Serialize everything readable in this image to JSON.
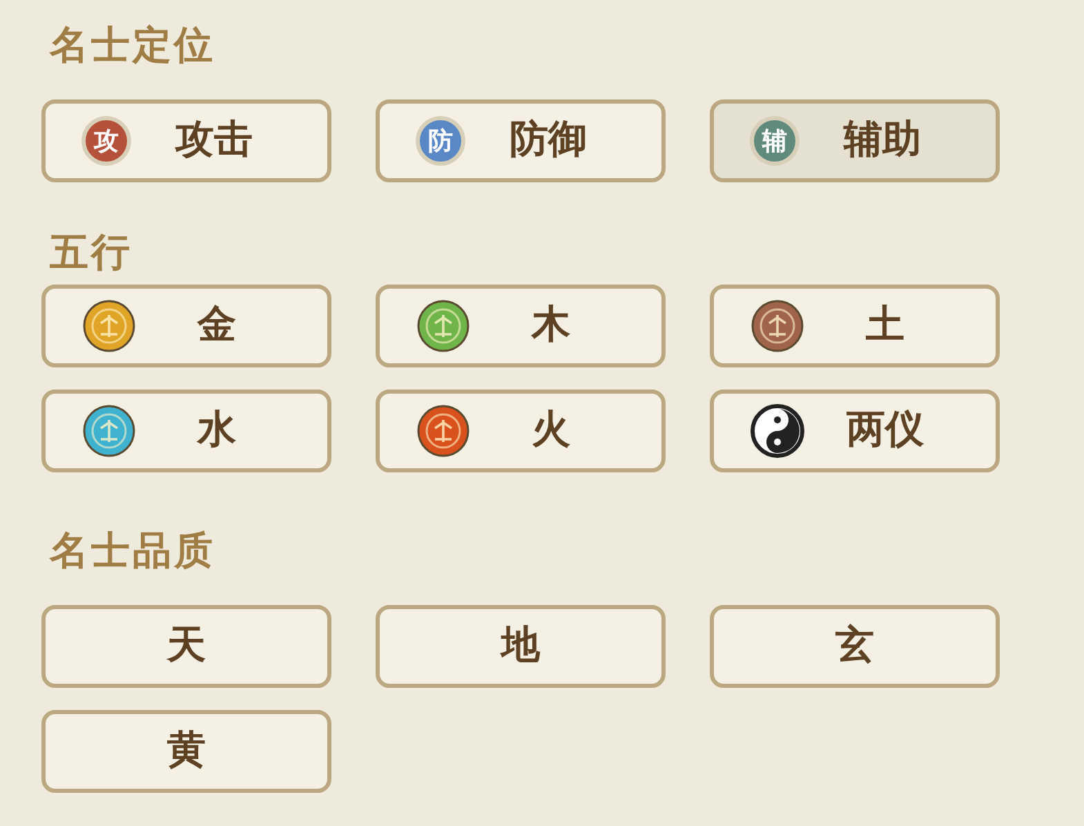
{
  "sections": [
    {
      "title": "名士定位",
      "options": [
        {
          "kind": "badge",
          "badge": "攻",
          "color": "#b5503b",
          "label": "攻击",
          "selected": false
        },
        {
          "kind": "badge",
          "badge": "防",
          "color": "#5a87c6",
          "label": "防御",
          "selected": false
        },
        {
          "kind": "badge",
          "badge": "辅",
          "color": "#5f8a7c",
          "label": "辅助",
          "selected": true
        }
      ]
    },
    {
      "title": "五行",
      "options": [
        {
          "kind": "element",
          "color": "#e0a526",
          "label": "金",
          "selected": false
        },
        {
          "kind": "element",
          "color": "#6fb54a",
          "label": "木",
          "selected": false
        },
        {
          "kind": "element",
          "color": "#a0644a",
          "label": "土",
          "selected": false
        },
        {
          "kind": "element",
          "color": "#3fb2cf",
          "label": "水",
          "selected": false
        },
        {
          "kind": "element",
          "color": "#d9511c",
          "label": "火",
          "selected": false
        },
        {
          "kind": "yinyang",
          "label": "两仪",
          "selected": false
        }
      ]
    },
    {
      "title": "名士品质",
      "options": [
        {
          "kind": "plain",
          "label": "天",
          "selected": false
        },
        {
          "kind": "plain",
          "label": "地",
          "selected": false
        },
        {
          "kind": "plain",
          "label": "玄",
          "selected": false
        },
        {
          "kind": "plain",
          "label": "黄",
          "selected": false
        }
      ]
    }
  ]
}
